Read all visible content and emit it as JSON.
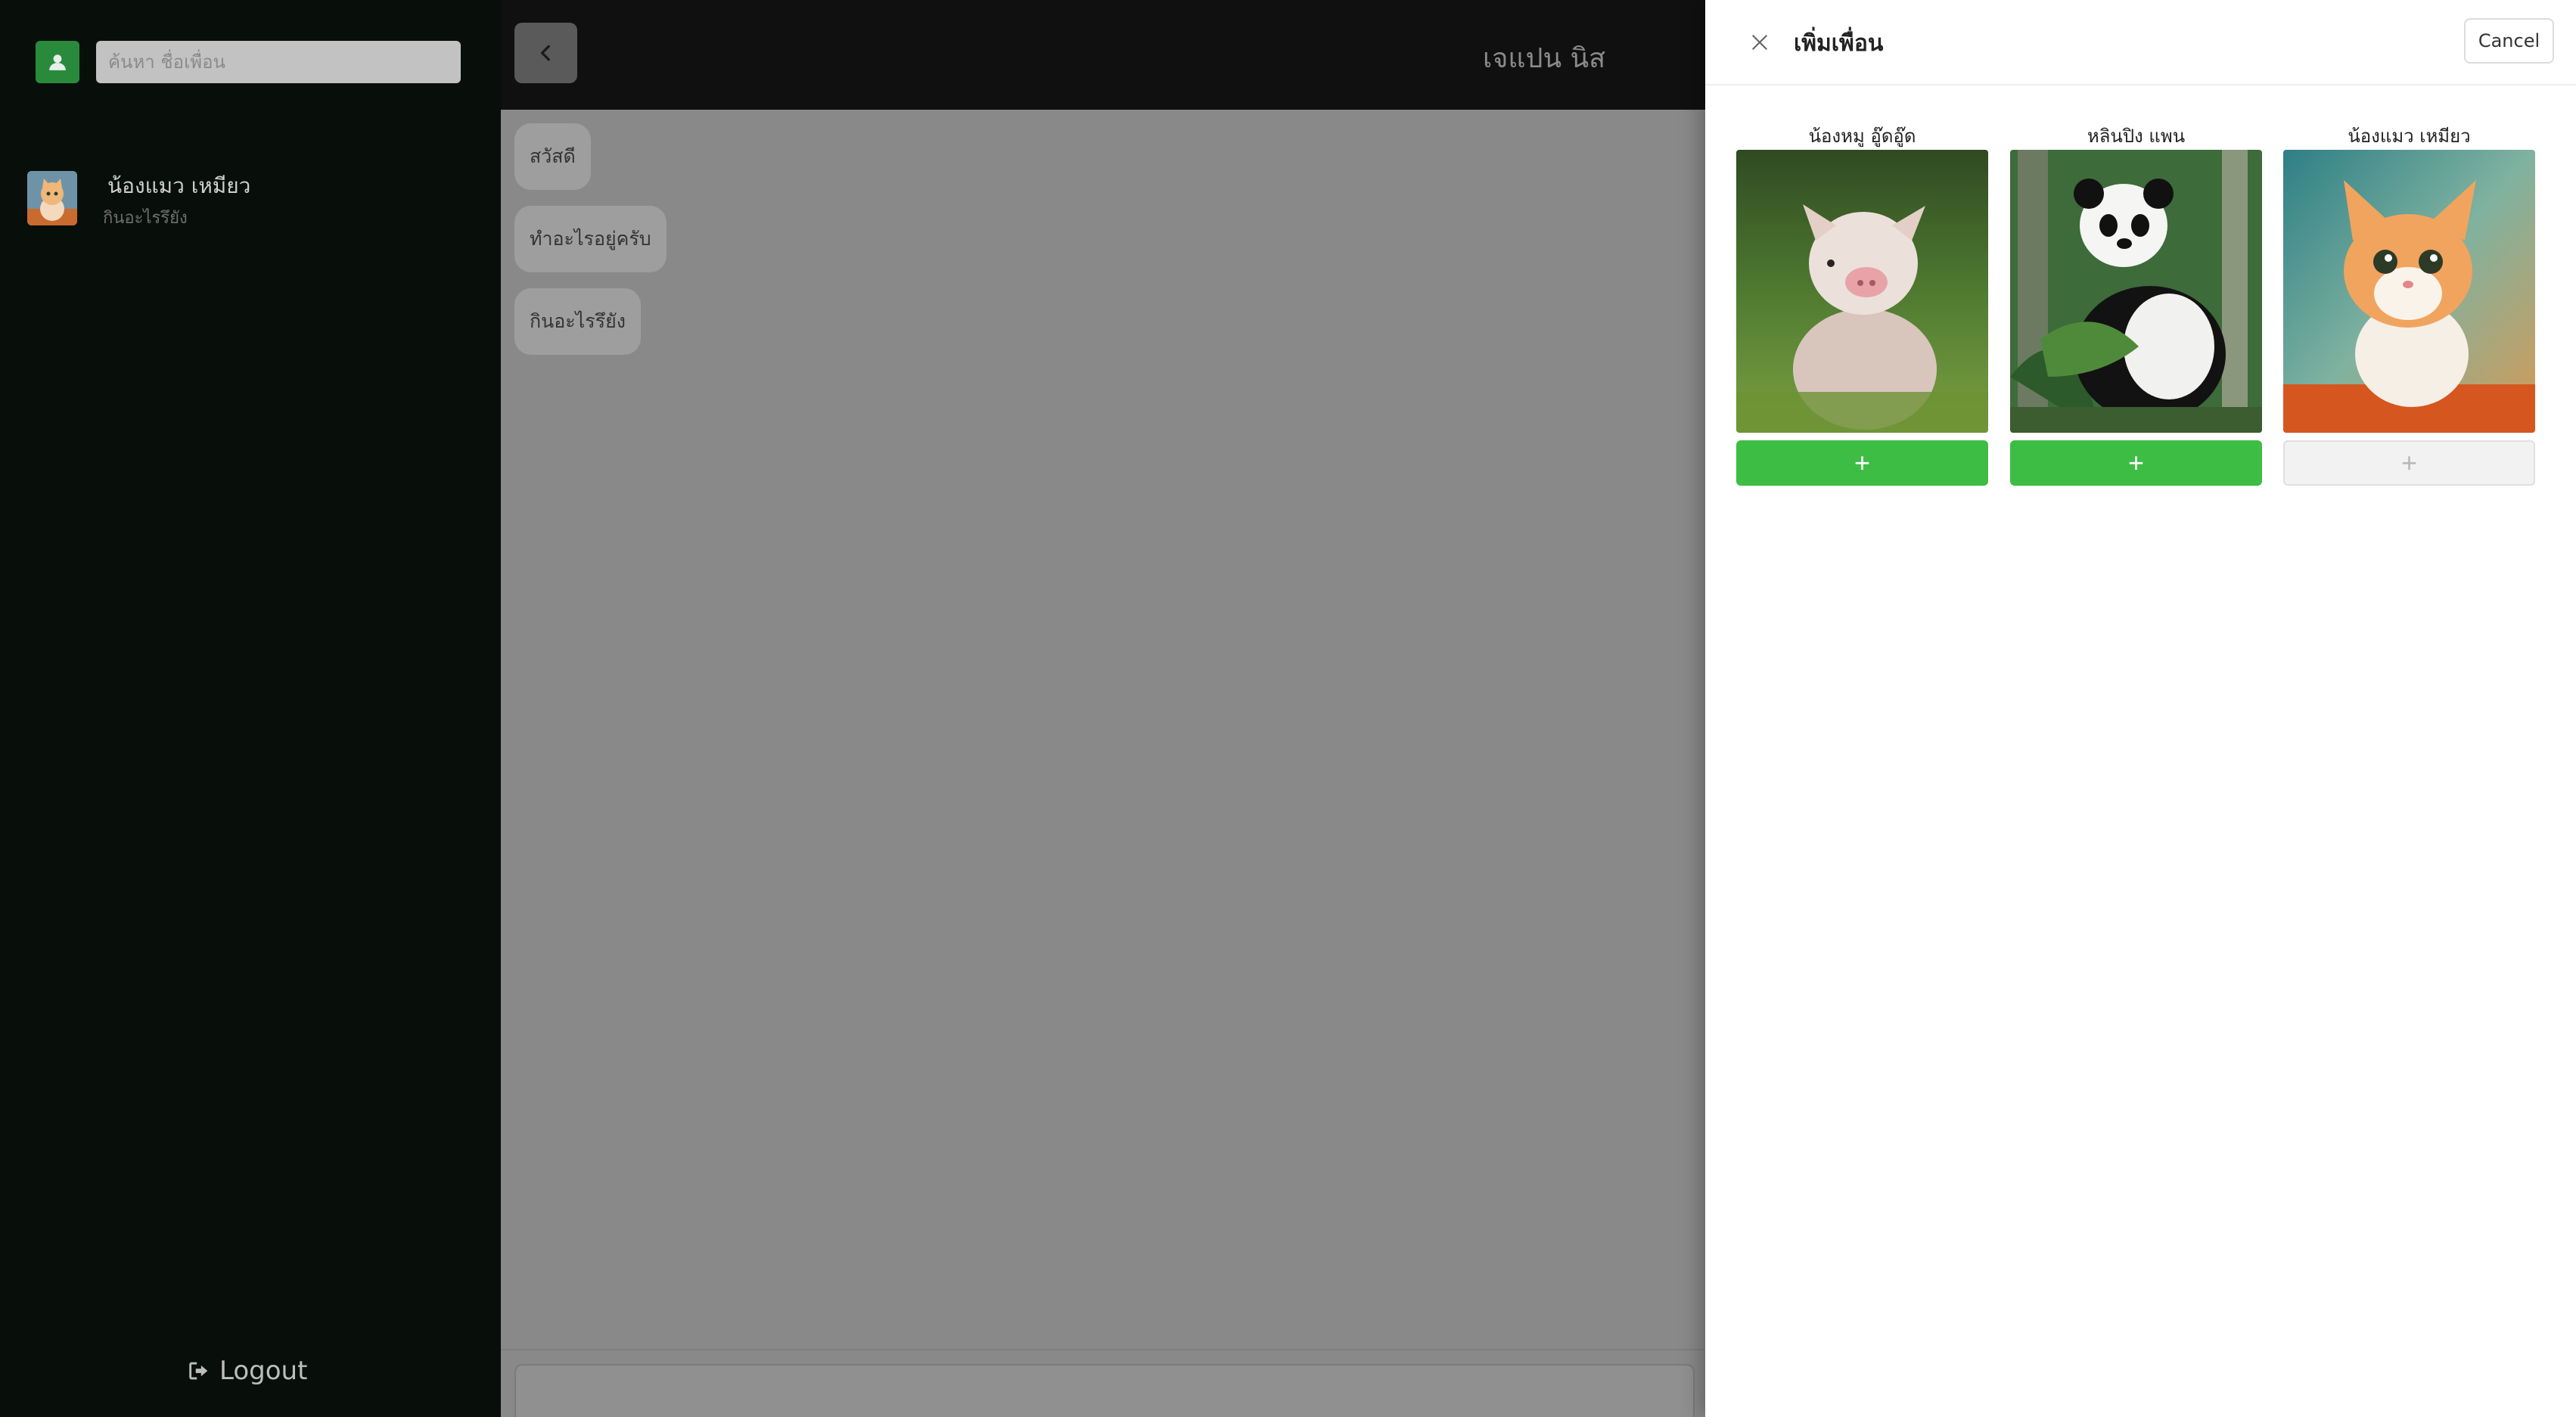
{
  "sidebar": {
    "search_placeholder": "ค้นหา ชื่อเพื่อน",
    "friends": [
      {
        "name": "น้องแมว เหมียว",
        "last_message": "กินอะไรรึยัง"
      }
    ],
    "logout_label": "Logout"
  },
  "chat": {
    "title": "เจแปน นิส",
    "messages": [
      {
        "text": "สวัสดี"
      },
      {
        "text": "ทำอะไรอยู่ครับ"
      },
      {
        "text": "กินอะไรรึยัง"
      }
    ]
  },
  "drawer": {
    "title": "เพิ่มเพื่อน",
    "cancel_label": "Cancel",
    "cards": [
      {
        "name": "น้องหมู อู๊ดอู๊ด",
        "add_label": "+",
        "added": false
      },
      {
        "name": "หลินปิง แพน",
        "add_label": "+",
        "added": false
      },
      {
        "name": "น้องแมว เหมียว",
        "add_label": "+",
        "added": true
      }
    ]
  },
  "colors": {
    "accent_green": "#3ebd45",
    "sidebar_bg": "#080f0b",
    "overlay_gray": "#898989"
  }
}
